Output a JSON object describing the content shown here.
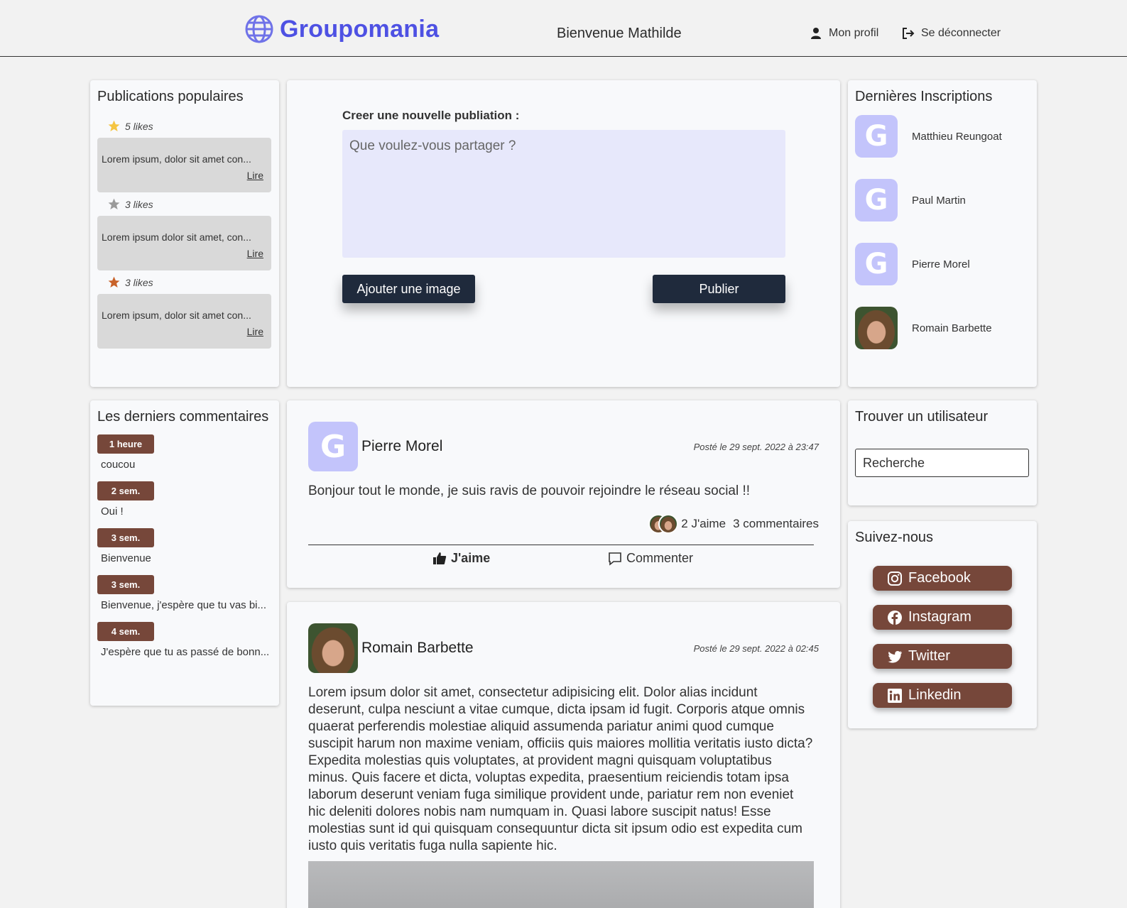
{
  "header": {
    "logo_text": "Groupomania",
    "welcome": "Bienvenue  Mathilde",
    "profile_label": "Mon profil",
    "logout_label": "Se déconnecter",
    "brand_color": "#4e51e3"
  },
  "popular": {
    "title": "Publications populaires",
    "items": [
      {
        "likes": "5 likes",
        "text": "Lorem ipsum, dolor sit amet con...",
        "link": "Lire",
        "star_color": "#f5c542"
      },
      {
        "likes": "3 likes",
        "text": "Lorem ipsum dolor sit amet, con...",
        "link": "Lire",
        "star_color": "#9a9a9a"
      },
      {
        "likes": "3 likes",
        "text": "Lorem ipsum, dolor sit amet con...",
        "link": "Lire",
        "star_color": "#c8622a"
      }
    ]
  },
  "new_post": {
    "label": "Creer une nouvelle publiation :",
    "placeholder": "Que voulez-vous partager ?",
    "add_image_label": "Ajouter une image",
    "publish_label": "Publier"
  },
  "signups": {
    "title": "Dernières Inscriptions",
    "users": [
      {
        "initial": "G",
        "name": "Matthieu Reungoat"
      },
      {
        "initial": "G",
        "name": "Paul Martin"
      },
      {
        "initial": "G",
        "name": "Pierre Morel"
      },
      {
        "initial": "",
        "name": "Romain Barbette"
      }
    ]
  },
  "comments": {
    "title": "Les derniers commentaires",
    "items": [
      {
        "time": "1 heure",
        "text": "coucou"
      },
      {
        "time": "2 sem.",
        "text": "Oui !"
      },
      {
        "time": "3 sem.",
        "text": "Bienvenue"
      },
      {
        "time": "3 sem.",
        "text": "Bienvenue, j'espère que tu vas bi..."
      },
      {
        "time": "4 sem.",
        "text": "J'espère que tu as passé de bonn..."
      }
    ]
  },
  "posts": [
    {
      "initial": "G",
      "author": "Pierre Morel",
      "date": "Posté le 29 sept. 2022 à 23:47",
      "body": "Bonjour tout le monde, je suis ravis de pouvoir rejoindre le réseau social !!",
      "likes": "2 J'aime",
      "comments": "3 commentaires",
      "like_label": "J'aime",
      "comment_label": "Commenter"
    },
    {
      "initial": "",
      "author": "Romain Barbette",
      "date": "Posté le 29 sept. 2022 à 02:45",
      "body": "Lorem ipsum dolor sit amet, consectetur adipisicing elit. Dolor alias incidunt deserunt, culpa nesciunt a vitae cumque, dicta ipsam id fugit. Corporis atque omnis quaerat perferendis molestiae aliquid assumenda pariatur animi quod cumque suscipit harum non maxime veniam, officiis quis maiores mollitia veritatis iusto dicta? Expedita molestias quis voluptates, at provident magni quisquam voluptatibus minus. Quis facere et dicta, voluptas expedita, praesentium reiciendis totam ipsa laborum deserunt veniam fuga similique provident unde, pariatur rem non eveniet hic deleniti dolores nobis nam numquam in. Quasi labore suscipit natus! Esse molestias sunt id qui quisquam consequuntur dicta sit ipsum odio est expedita cum iusto quis veritatis fuga nulla sapiente hic."
    }
  ],
  "search": {
    "title": "Trouver un utilisateur",
    "placeholder": "Recherche"
  },
  "social": {
    "title": "Suivez-nous",
    "links": [
      {
        "label": "Facebook",
        "icon": "instagram-icon"
      },
      {
        "label": "Instagram",
        "icon": "facebook-icon"
      },
      {
        "label": "Twitter",
        "icon": "twitter-icon"
      },
      {
        "label": "Linkedin",
        "icon": "linkedin-icon"
      }
    ],
    "color": "#76473a"
  }
}
